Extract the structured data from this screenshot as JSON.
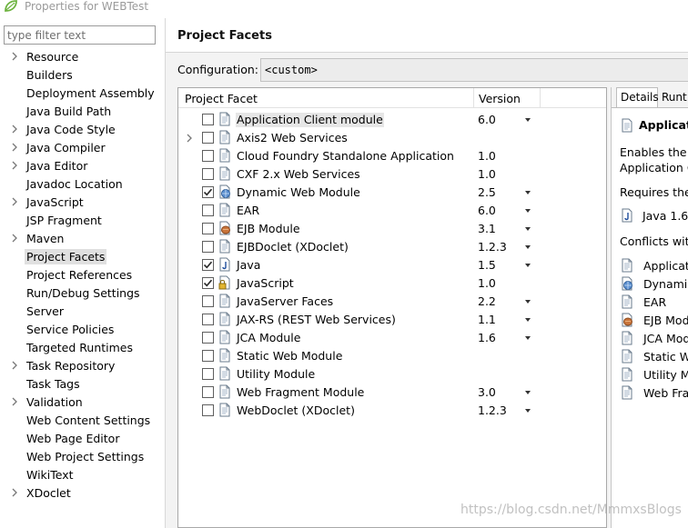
{
  "window": {
    "title": "Properties for WEBTest"
  },
  "sidebar": {
    "filter_placeholder": "type filter text",
    "items": [
      {
        "label": "Resource",
        "expandable": true
      },
      {
        "label": "Builders",
        "expandable": false
      },
      {
        "label": "Deployment Assembly",
        "expandable": false
      },
      {
        "label": "Java Build Path",
        "expandable": false
      },
      {
        "label": "Java Code Style",
        "expandable": true
      },
      {
        "label": "Java Compiler",
        "expandable": true
      },
      {
        "label": "Java Editor",
        "expandable": true
      },
      {
        "label": "Javadoc Location",
        "expandable": false
      },
      {
        "label": "JavaScript",
        "expandable": true
      },
      {
        "label": "JSP Fragment",
        "expandable": false
      },
      {
        "label": "Maven",
        "expandable": true
      },
      {
        "label": "Project Facets",
        "expandable": false,
        "selected": true
      },
      {
        "label": "Project References",
        "expandable": false
      },
      {
        "label": "Run/Debug Settings",
        "expandable": false
      },
      {
        "label": "Server",
        "expandable": false
      },
      {
        "label": "Service Policies",
        "expandable": false
      },
      {
        "label": "Targeted Runtimes",
        "expandable": false
      },
      {
        "label": "Task Repository",
        "expandable": true
      },
      {
        "label": "Task Tags",
        "expandable": false
      },
      {
        "label": "Validation",
        "expandable": true
      },
      {
        "label": "Web Content Settings",
        "expandable": false
      },
      {
        "label": "Web Page Editor",
        "expandable": false
      },
      {
        "label": "Web Project Settings",
        "expandable": false
      },
      {
        "label": "WikiText",
        "expandable": false
      },
      {
        "label": "XDoclet",
        "expandable": true
      }
    ]
  },
  "page": {
    "title": "Project Facets",
    "configuration_label": "Configuration:",
    "configuration_value": "<custom>"
  },
  "facets": {
    "col_facet": "Project Facet",
    "col_version": "Version",
    "rows": [
      {
        "name": "Application Client module",
        "version": "6.0",
        "checked": false,
        "dropdown": true,
        "expandable": false,
        "highlighted": true,
        "icon": "page-icon"
      },
      {
        "name": "Axis2 Web Services",
        "version": "",
        "checked": false,
        "dropdown": false,
        "expandable": true,
        "highlighted": false,
        "icon": "page-icon"
      },
      {
        "name": "Cloud Foundry Standalone Application",
        "version": "1.0",
        "checked": false,
        "dropdown": false,
        "expandable": false,
        "highlighted": false,
        "icon": "page-icon"
      },
      {
        "name": "CXF 2.x Web Services",
        "version": "1.0",
        "checked": false,
        "dropdown": false,
        "expandable": false,
        "highlighted": false,
        "icon": "page-icon"
      },
      {
        "name": "Dynamic Web Module",
        "version": "2.5",
        "checked": true,
        "dropdown": true,
        "expandable": false,
        "highlighted": false,
        "icon": "globe-page-icon"
      },
      {
        "name": "EAR",
        "version": "6.0",
        "checked": false,
        "dropdown": true,
        "expandable": false,
        "highlighted": false,
        "icon": "page-icon"
      },
      {
        "name": "EJB Module",
        "version": "3.1",
        "checked": false,
        "dropdown": true,
        "expandable": false,
        "highlighted": false,
        "icon": "bean-page-icon"
      },
      {
        "name": "EJBDoclet (XDoclet)",
        "version": "1.2.3",
        "checked": false,
        "dropdown": true,
        "expandable": false,
        "highlighted": false,
        "icon": "page-icon"
      },
      {
        "name": "Java",
        "version": "1.5",
        "checked": true,
        "dropdown": true,
        "expandable": false,
        "highlighted": false,
        "icon": "java-page-icon"
      },
      {
        "name": "JavaScript",
        "version": "1.0",
        "checked": true,
        "dropdown": false,
        "expandable": false,
        "highlighted": false,
        "icon": "locked-page-icon"
      },
      {
        "name": "JavaServer Faces",
        "version": "2.2",
        "checked": false,
        "dropdown": true,
        "expandable": false,
        "highlighted": false,
        "icon": "page-icon"
      },
      {
        "name": "JAX-RS (REST Web Services)",
        "version": "1.1",
        "checked": false,
        "dropdown": true,
        "expandable": false,
        "highlighted": false,
        "icon": "page-icon"
      },
      {
        "name": "JCA Module",
        "version": "1.6",
        "checked": false,
        "dropdown": true,
        "expandable": false,
        "highlighted": false,
        "icon": "page-icon"
      },
      {
        "name": "Static Web Module",
        "version": "",
        "checked": false,
        "dropdown": false,
        "expandable": false,
        "highlighted": false,
        "icon": "page-icon"
      },
      {
        "name": "Utility Module",
        "version": "",
        "checked": false,
        "dropdown": false,
        "expandable": false,
        "highlighted": false,
        "icon": "page-icon"
      },
      {
        "name": "Web Fragment Module",
        "version": "3.0",
        "checked": false,
        "dropdown": true,
        "expandable": false,
        "highlighted": false,
        "icon": "page-icon"
      },
      {
        "name": "WebDoclet (XDoclet)",
        "version": "1.2.3",
        "checked": false,
        "dropdown": true,
        "expandable": false,
        "highlighted": false,
        "icon": "page-icon"
      }
    ]
  },
  "details": {
    "tab_details": "Details",
    "tab_runtimes": "Runt",
    "title": "Applicati",
    "description_line1": "Enables the p",
    "description_line2": "Application C",
    "requires_label": "Requires the",
    "requires_item": "Java 1.6",
    "conflicts_label": "Conflicts with",
    "conflicts": [
      {
        "label": "Applicati",
        "icon": "page-icon"
      },
      {
        "label": "Dynamic",
        "icon": "globe-page-icon"
      },
      {
        "label": "EAR",
        "icon": "page-icon"
      },
      {
        "label": "EJB Mod",
        "icon": "bean-page-icon"
      },
      {
        "label": "JCA Mod",
        "icon": "page-icon"
      },
      {
        "label": "Static W",
        "icon": "page-icon"
      },
      {
        "label": "Utility M",
        "icon": "page-icon"
      },
      {
        "label": "Web Fra",
        "icon": "page-icon"
      }
    ]
  },
  "watermark": "https://blog.csdn.net/MmmxsBlogs",
  "colors": {
    "selection": "#e0e0e0",
    "panel_bg": "#f3f3f3",
    "check": "#2a2a2a"
  }
}
